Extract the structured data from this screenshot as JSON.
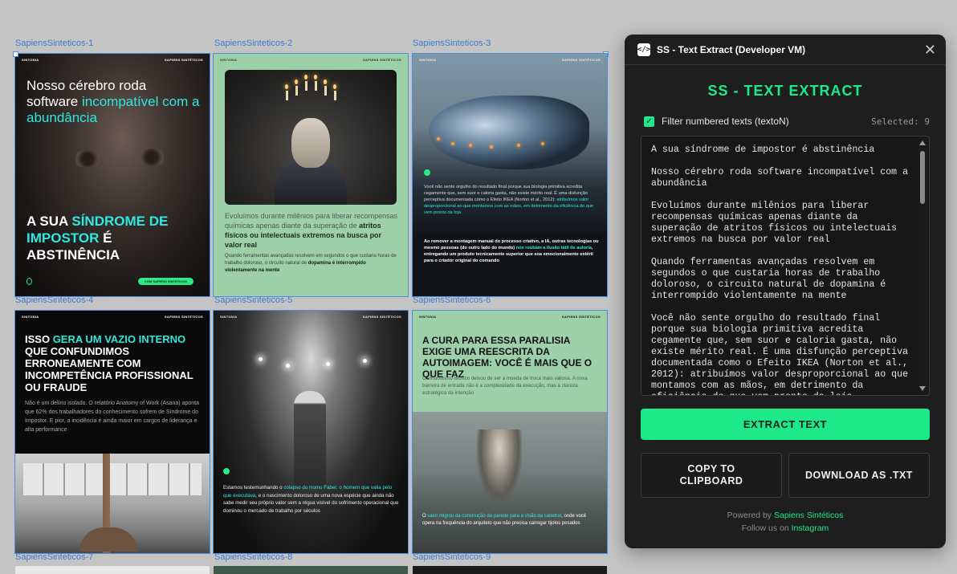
{
  "canvas": {
    "frames": [
      {
        "label": "SapiensSinteticos-1"
      },
      {
        "label": "SapiensSinteticos-2"
      },
      {
        "label": "SapiensSinteticos-3"
      },
      {
        "label": "SapiensSinteticos-4"
      },
      {
        "label": "SapiensSinteticos-5"
      },
      {
        "label": "SapiensSinteticos-6"
      },
      {
        "label": "SapiensSinteticos-7"
      },
      {
        "label": "SapiensSinteticos-8"
      },
      {
        "label": "SapiensSinteticos-9"
      }
    ],
    "brand_left": "SINTONIA",
    "brand_right": "SAPIENS SINTÉTICOS",
    "f1": {
      "headline_a": "Nosso cérebro roda software ",
      "headline_b": "incompatível com a abundância",
      "big_a": "A sua ",
      "big_b": "síndrome de impostor",
      "big_c": " é abstinência",
      "pill": "COM SAPIENS SINTÉTICOS"
    },
    "f2": {
      "t1_a": "Evoluímos durante milênios para liberar recompensas químicas apenas diante da superação de ",
      "t1_b": "atritos físicos ou intelectuais extremos na busca por valor real",
      "t2_a": "Quando ferramentas avançadas resolvem em segundos o que custaria horas de trabalho doloroso, o circuito natural de ",
      "t2_b": "dopamina é interrompido violentamente na mente"
    },
    "f3": {
      "t1_a": "Você não sente orgulho do resultado final porque sua biologia primitiva acredita cegamente que, sem suor e caloria gasta, não existe mérito real. É uma disfunção perceptiva documentada como o Efeito IKEA (Norton et al., 2012): ",
      "t1_b": "atribuímos valor desproporcional ao que montamos com as mãos, em detrimento da eficiência do que vem pronto da loja",
      "t2_a": "Ao remover a montagem manual do processo criativo, a IA, outras tecnologias ou mesmo pessoas (do outro lado do mundo) ",
      "t2_b": "nos roubam a ilusão tátil de autoria",
      "t2_c": ", entregando um produto tecnicamente superior que soa emocionalmente estéril para o criador original do comando"
    },
    "f4": {
      "big_a": "Isso ",
      "big_b": "gera um vazio interno",
      "big_c": " que confundimos erroneamente com incompetência profissional ou fraude",
      "p": "Não é um delírio isolado. O relatório Anatomy of Work (Asana) aponta que 62% dos trabalhadores do conhecimento sofrem de Síndrome do Impostor. E pior, a incidência é ainda maior em cargos de liderança e alta performance"
    },
    "f5": {
      "t_a": "Estamos testemunhando o ",
      "t_b": "colapso do Homo Faber, o homem que valia pelo que executava",
      "t_c": ", e o nascimento doloroso de uma nova espécie que ainda não sabe medir seu próprio valor sem a régua visível do sofrimento operacional que dominou o mercado de trabalho por séculos"
    },
    "f6": {
      "big": "A cura para essa paralisia exige uma reescrita da autoimagem: você é mais que o que faz",
      "p": "O virtuosismo técnico deixou de ser a moeda de troca mais valiosa. A nova barreira de entrada não é a complexidade da execução, mas a clareza estratégica da intenção",
      "t_a": "O ",
      "t_b": "valor migrou da construção da parede para a visão da catedral",
      "t_c": ", onde você opera na frequência do arquiteto que não precisa carregar tijolos pesados"
    }
  },
  "plugin": {
    "window_title": "SS - Text Extract (Developer VM)",
    "icon_glyph": "</>",
    "heading": "SS - TEXT EXTRACT",
    "filter_label": "Filter numbered texts (textoN)",
    "filter_checked": true,
    "selected_text": "Selected: 9",
    "extracted": [
      "A sua síndrome de impostor é abstinência",
      "Nosso cérebro roda software incompatível com a abundância",
      "Evoluímos durante milênios para liberar recompensas químicas apenas diante da superação de atritos físicos ou intelectuais extremos na busca por valor real",
      "Quando ferramentas avançadas resolvem em segundos o que custaria horas de trabalho doloroso, o circuito natural de dopamina é interrompido violentamente na mente",
      "Você não sente orgulho do resultado final porque sua biologia primitiva acredita cegamente que, sem suor e caloria gasta, não existe mérito real. É uma disfunção perceptiva documentada como o Efeito IKEA (Norton et al., 2012): atribuímos valor desproporcional ao que montamos com as mãos, em detrimento da eficiência do que vem pronto da loja"
    ],
    "extract_button": "EXTRACT TEXT",
    "copy_button": "COPY TO CLIPBOARD",
    "download_button": "DOWNLOAD AS .TXT",
    "footer_powered": "Powered by ",
    "footer_brand": "Sapiens Sintéticos",
    "footer_follow": "Follow us on ",
    "footer_instagram": "Instagram",
    "accent_color": "#1de98b"
  }
}
